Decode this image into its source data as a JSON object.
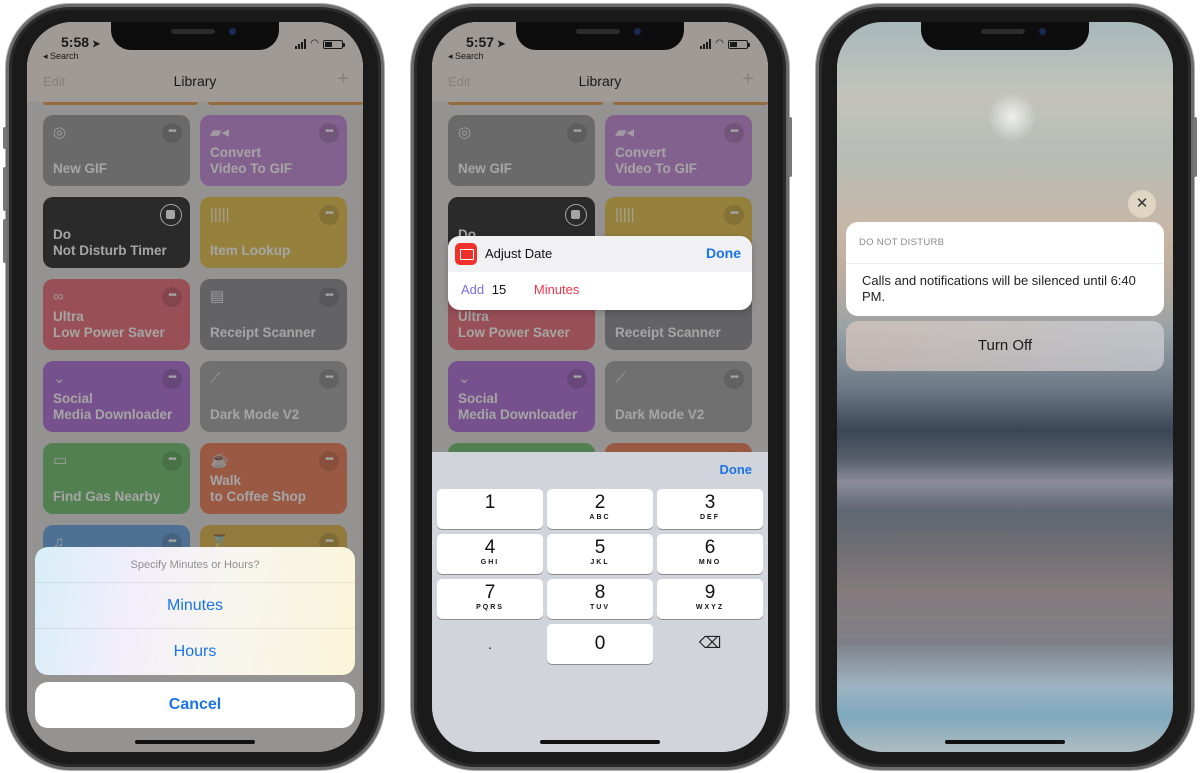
{
  "phone1": {
    "status": {
      "time": "5:58",
      "back_label": "◂ Search",
      "battery_fraction": 0.45
    },
    "nav": {
      "edit": "Edit",
      "title": "Library",
      "add": "+"
    },
    "tiles": [
      {
        "label": "New GIF",
        "icon": "target-icon",
        "glyph": "◎",
        "color": "#9a9a9a",
        "action": "more"
      },
      {
        "label": "Convert\nVideo To GIF",
        "icon": "video-camera-icon",
        "glyph": "▰◂",
        "color": "#c58ad8",
        "action": "more"
      },
      {
        "label": "Do\nNot Disturb Timer",
        "icon": "",
        "glyph": "",
        "color": "#2c2c2e",
        "action": "stop"
      },
      {
        "label": "Item Lookup",
        "icon": "barcode-icon",
        "glyph": "|||||",
        "color": "#e5c24a",
        "action": "more"
      },
      {
        "label": "Ultra\nLow Power Saver",
        "icon": "infinity-icon",
        "glyph": "∞",
        "color": "#ea6b78",
        "action": "more"
      },
      {
        "label": "Receipt Scanner",
        "icon": "document-icon",
        "glyph": "▤",
        "color": "#8e8e93",
        "action": "more"
      },
      {
        "label": "Social\nMedia Downloader",
        "icon": "chevron-circle-down-icon",
        "glyph": "⌄",
        "color": "#b06ed6",
        "action": "more"
      },
      {
        "label": "Dark Mode V2",
        "icon": "magic-wand-icon",
        "glyph": "⟋",
        "color": "#a4a4a4",
        "action": "more"
      },
      {
        "label": "Find Gas Nearby",
        "icon": "car-icon",
        "glyph": "▭",
        "color": "#72c06d",
        "action": "more"
      },
      {
        "label": "Walk\nto Coffee Shop",
        "icon": "coffee-cup-icon",
        "glyph": "☕",
        "color": "#ed7d57",
        "action": "more"
      },
      {
        "label": "",
        "icon": "music-note-icon",
        "glyph": "♫",
        "color": "#6aa4de",
        "action": "more"
      },
      {
        "label": "",
        "icon": "hourglass-icon",
        "glyph": "⌛",
        "color": "#ddb54a",
        "action": "more"
      }
    ],
    "sheet": {
      "title": "Specify Minutes or Hours?",
      "options": [
        "Minutes",
        "Hours"
      ],
      "cancel": "Cancel"
    }
  },
  "phone2": {
    "status": {
      "time": "5:57",
      "back_label": "◂ Search",
      "battery_fraction": 0.45
    },
    "nav": {
      "edit": "Edit",
      "title": "Library",
      "add": "+"
    },
    "adjust": {
      "title": "Adjust Date",
      "done": "Done",
      "verb": "Add",
      "value": "15",
      "unit": "Minutes"
    },
    "keyboard": {
      "done": "Done",
      "keys": [
        {
          "d": "1",
          "l": ""
        },
        {
          "d": "2",
          "l": "ABC"
        },
        {
          "d": "3",
          "l": "DEF"
        },
        {
          "d": "4",
          "l": "GHI"
        },
        {
          "d": "5",
          "l": "JKL"
        },
        {
          "d": "6",
          "l": "MNO"
        },
        {
          "d": "7",
          "l": "PQRS"
        },
        {
          "d": "8",
          "l": "TUV"
        },
        {
          "d": "9",
          "l": "WXYZ"
        }
      ],
      "dot": ".",
      "zero": "0",
      "delete": "⌫"
    }
  },
  "phone3": {
    "close": "✕",
    "notification": {
      "app": "DO NOT DISTURB",
      "body": "Calls and notifications will be silenced until 6:40 PM."
    },
    "turn_off": "Turn Off"
  },
  "colors": {
    "ios_blue": "#1a74e8",
    "add_purple": "#7a6ee8",
    "minutes_red": "#f0344c",
    "calendar_red": "#f0302a"
  }
}
